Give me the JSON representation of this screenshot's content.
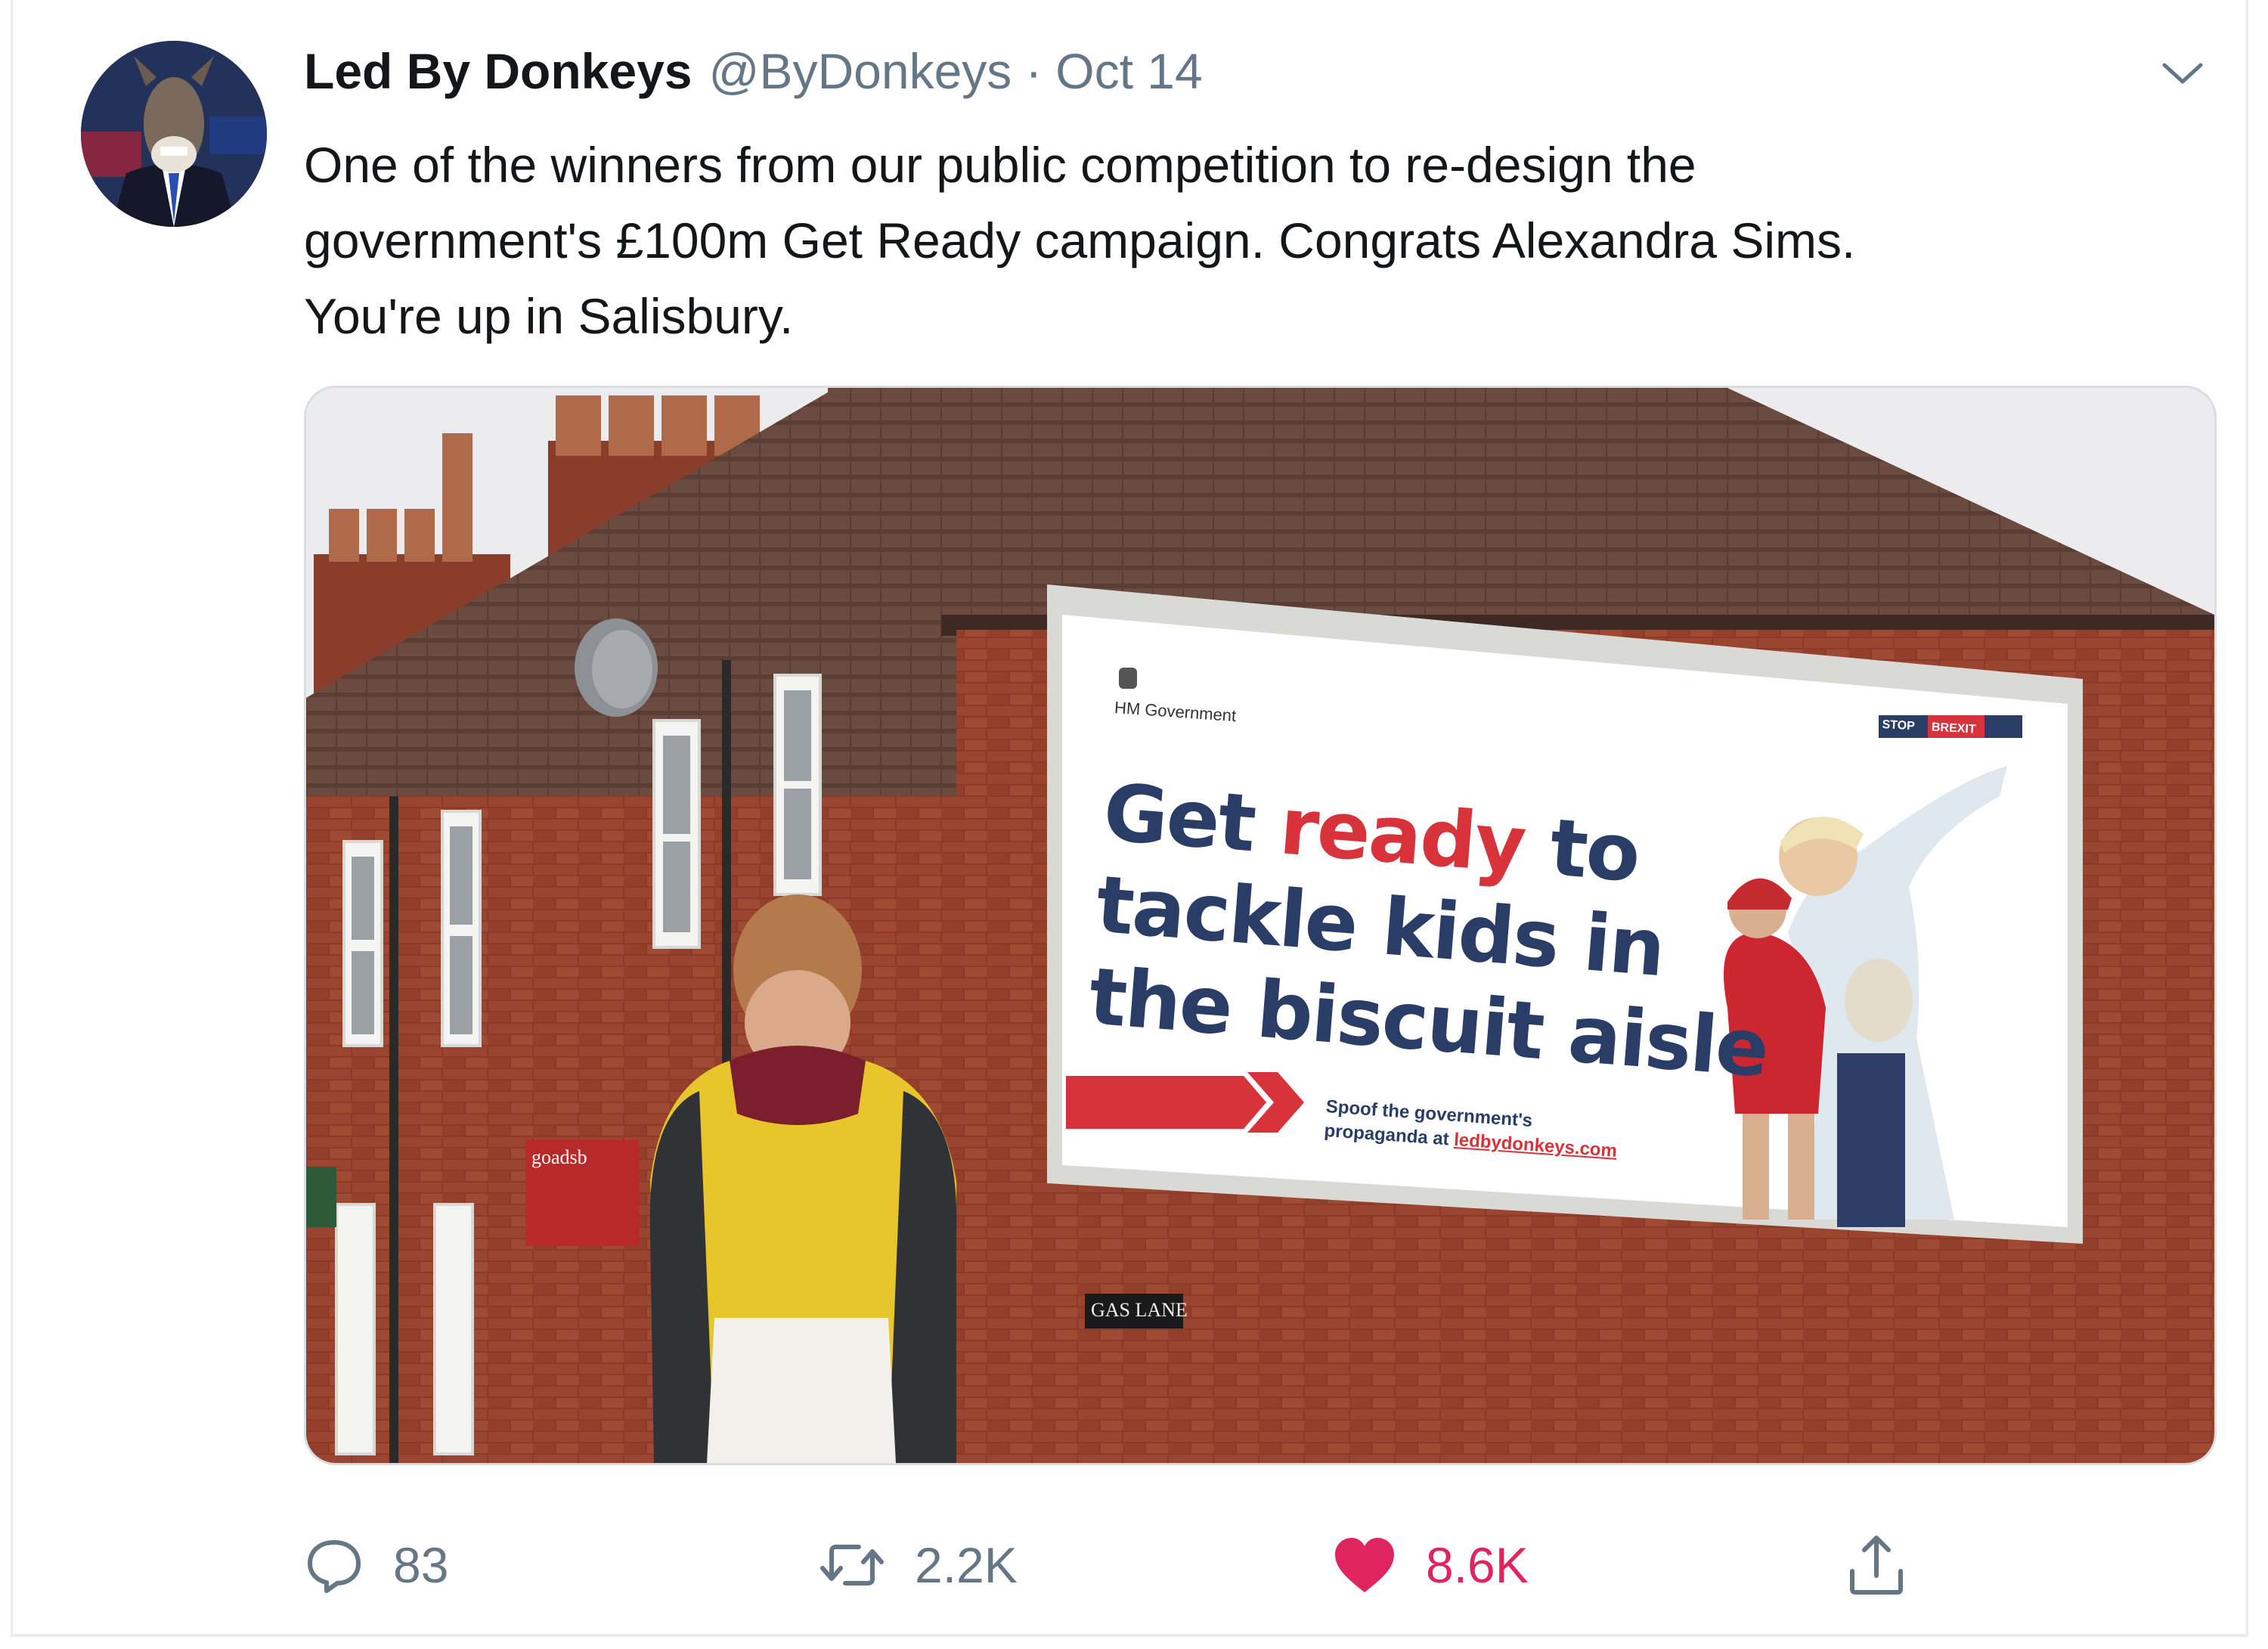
{
  "tweet": {
    "author_name": "Led By Donkeys",
    "handle": "@ByDonkeys",
    "separator": "·",
    "date": "Oct 14",
    "text_lines": [
      "One of the winners from our public competition to re-design the",
      "government's £100m Get Ready campaign. Congrats Alexandra Sims.",
      "You're up in Salisbury."
    ]
  },
  "media": {
    "billboard": {
      "org": "HM Government",
      "headline_line1_a": "Get ",
      "headline_line1_b": "ready",
      "headline_line1_c": " to",
      "headline_line2": "tackle kids in",
      "headline_line3": "the biscuit aisle",
      "badge_stop": "STOP",
      "badge_brexit": "BREXIT",
      "footer_line1": "Spoof the government's",
      "footer_line2_a": "propaganda at ",
      "footer_line2_b": "ledbydonkeys.com"
    },
    "street_sign": "GAS LANE",
    "estate_sign": "goadsb"
  },
  "actions": {
    "replies": "83",
    "retweets": "2.2K",
    "likes": "8.6K"
  },
  "colors": {
    "accent_like": "#e0245e",
    "muted": "#657786",
    "billboard_navy": "#2a3d66",
    "billboard_red": "#d8323a"
  },
  "icons": [
    "reply-icon",
    "retweet-icon",
    "heart-icon",
    "share-icon",
    "chevron-down-icon"
  ]
}
